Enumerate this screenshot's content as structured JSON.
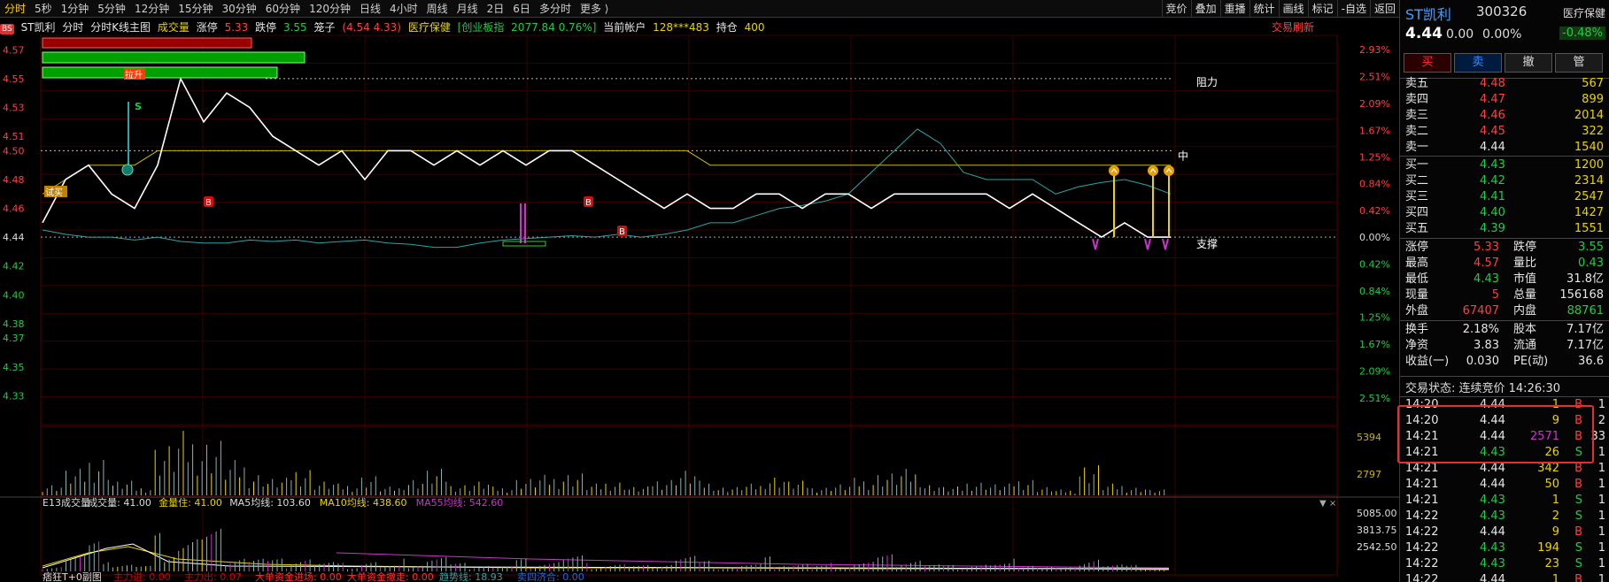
{
  "toolbar": {
    "periods": [
      "分时",
      "5秒",
      "1分钟",
      "5分钟",
      "12分钟",
      "15分钟",
      "30分钟",
      "60分钟",
      "120分钟",
      "日线",
      "4小时",
      "周线",
      "月线",
      "2日",
      "6日",
      "多分时",
      "更多 ⟩"
    ],
    "active_period": 0,
    "tools": [
      "竞价",
      "叠加",
      "重播",
      "统计",
      "画线",
      "标记",
      "-自选",
      "返回"
    ]
  },
  "infoline": {
    "tag": "BS",
    "stock": "ST凯利",
    "mode": "分时",
    "main_chart": "分时K线主图",
    "volume_label": "成交量",
    "limit_up_label": "涨停",
    "limit_up": "5.33",
    "limit_down_label": "跌停",
    "limit_down": "3.55",
    "box_label": "笼子",
    "box_value": "(4.54 4.33)",
    "sector": "医疗保健",
    "index_label": "[创业板指",
    "index_value": "2077.84 0.76%]",
    "account_label": "当前帐户",
    "account": "128***483",
    "position_label": "持仓",
    "position": "400",
    "trade_refresh": "交易刷新"
  },
  "price_axis": [
    "4.57",
    "4.55",
    "4.53",
    "4.51",
    "4.50",
    "4.48",
    "4.46",
    "4.44",
    "4.42",
    "4.40",
    "4.38",
    "4.37",
    "4.35",
    "4.33"
  ],
  "pct_axis_up": [
    "2.93%",
    "2.51%",
    "2.09%",
    "1.67%",
    "1.25%",
    "0.84%",
    "0.42%",
    "0.00%"
  ],
  "pct_axis_down": [
    "0.42%",
    "0.84%",
    "1.25%",
    "1.67%",
    "2.09%",
    "2.51%"
  ],
  "annotations": {
    "resistance": "阻力",
    "middle": "中",
    "support": "支撑",
    "rise": "拉升",
    "buy": "试买",
    "b": "B",
    "s": "S"
  },
  "volume_axis": [
    "5394",
    "2797"
  ],
  "e13": {
    "title": "E13成交量",
    "vol_label": "成交量: 41.00",
    "amount_label": "金量住: 41.00",
    "ma5": "MA5均线: 103.60",
    "ma10": "MA10均线: 438.60",
    "ma55": "MA55均线: 542.60",
    "axis": [
      "5085.00",
      "3813.75",
      "2542.50"
    ]
  },
  "bottom_line": {
    "title": "痞狂T+0副图",
    "items": [
      "主力进: 0.00",
      "主力出: 0.07",
      "大单资金进场: 0.00",
      "大单资金撤走: 0.00",
      "趋势线: 18.93",
      "卖四济合: 0.00"
    ]
  },
  "chart_data": {
    "type": "line",
    "title": "ST凯利 分时",
    "series": [
      {
        "name": "price",
        "values": [
          4.45,
          4.48,
          4.49,
          4.47,
          4.46,
          4.49,
          4.55,
          4.52,
          4.54,
          4.53,
          4.51,
          4.5,
          4.49,
          4.5,
          4.48,
          4.5,
          4.5,
          4.49,
          4.5,
          4.49,
          4.5,
          4.49,
          4.5,
          4.5,
          4.49,
          4.48,
          4.47,
          4.46,
          4.47,
          4.46,
          4.46,
          4.47,
          4.47,
          4.46,
          4.47,
          4.47,
          4.46,
          4.47,
          4.47,
          4.47,
          4.47,
          4.47,
          4.46,
          4.47,
          4.46,
          4.45,
          4.44,
          4.45,
          4.44,
          4.44
        ]
      },
      {
        "name": "avg",
        "values": [
          4.47,
          4.48,
          4.49,
          4.49,
          4.49,
          4.5,
          4.5,
          4.5,
          4.5,
          4.5,
          4.5,
          4.5,
          4.5,
          4.5,
          4.5,
          4.5,
          4.5,
          4.5,
          4.5,
          4.5,
          4.5,
          4.5,
          4.5,
          4.5,
          4.5,
          4.5,
          4.5,
          4.5,
          4.5,
          4.49,
          4.49,
          4.49,
          4.49,
          4.49,
          4.49,
          4.49,
          4.49,
          4.49,
          4.49,
          4.49,
          4.49,
          4.49,
          4.49,
          4.49,
          4.49,
          4.49,
          4.49,
          4.49,
          4.49,
          4.49
        ]
      },
      {
        "name": "index",
        "values": [
          4.445,
          4.442,
          4.44,
          4.44,
          4.438,
          4.44,
          4.437,
          4.436,
          4.436,
          4.438,
          4.437,
          4.438,
          4.436,
          4.437,
          4.438,
          4.436,
          4.435,
          4.433,
          4.433,
          4.436,
          4.438,
          4.439,
          4.44,
          4.441,
          4.44,
          4.442,
          4.44,
          4.442,
          4.445,
          4.45,
          4.45,
          4.455,
          4.46,
          4.462,
          4.465,
          4.47,
          4.485,
          4.5,
          4.515,
          4.505,
          4.485,
          4.48,
          4.48,
          4.48,
          4.47,
          4.475,
          4.478,
          4.48,
          4.476,
          4.47
        ]
      }
    ],
    "ylim": [
      4.31,
      4.58
    ],
    "reference_price": 4.44,
    "volume": [
      4,
      9,
      14,
      5,
      3,
      18,
      22,
      20,
      12,
      8,
      6,
      10,
      5,
      4,
      7,
      3,
      6,
      9,
      4,
      5,
      3,
      6,
      7,
      8,
      4,
      5,
      3,
      6,
      9,
      5,
      3,
      4,
      7,
      5,
      3,
      4,
      6,
      8,
      9,
      4,
      3,
      5,
      4,
      6,
      3,
      2,
      11,
      4,
      3,
      2
    ]
  },
  "right_panel": {
    "name": "ST凯利",
    "code": "300326",
    "sector": "医疗保健",
    "price": "4.44",
    "change": "0.00",
    "change_pct": "0.00%",
    "sector_pct": "-0.48%",
    "buttons": [
      "买",
      "卖",
      "撤",
      "管"
    ],
    "asks": [
      {
        "label": "卖五",
        "price": "4.48",
        "vol": "567"
      },
      {
        "label": "卖四",
        "price": "4.47",
        "vol": "899"
      },
      {
        "label": "卖三",
        "price": "4.46",
        "vol": "2014"
      },
      {
        "label": "卖二",
        "price": "4.45",
        "vol": "322"
      },
      {
        "label": "卖一",
        "price": "4.44",
        "vol": "1540"
      }
    ],
    "bids": [
      {
        "label": "买一",
        "price": "4.43",
        "vol": "1200"
      },
      {
        "label": "买二",
        "price": "4.42",
        "vol": "2314"
      },
      {
        "label": "买三",
        "price": "4.41",
        "vol": "2547"
      },
      {
        "label": "买四",
        "price": "4.40",
        "vol": "1427"
      },
      {
        "label": "买五",
        "price": "4.39",
        "vol": "1551"
      }
    ],
    "stats": [
      {
        "l1": "涨停",
        "v1": "5.33",
        "c1": "c-red",
        "l2": "跌停",
        "v2": "3.55",
        "c2": "c-green"
      },
      {
        "l1": "最高",
        "v1": "4.57",
        "c1": "c-red",
        "l2": "量比",
        "v2": "0.43",
        "c2": "c-green"
      },
      {
        "l1": "最低",
        "v1": "4.43",
        "c1": "c-green",
        "l2": "市值",
        "v2": "31.8亿",
        "c2": "c-white"
      },
      {
        "l1": "现量",
        "v1": "5",
        "c1": "c-red",
        "l2": "总量",
        "v2": "156168",
        "c2": "c-white"
      },
      {
        "l1": "外盘",
        "v1": "67407",
        "c1": "c-red",
        "l2": "内盘",
        "v2": "88761",
        "c2": "c-green"
      }
    ],
    "stats2": [
      {
        "l1": "换手",
        "v1": "2.18%",
        "l2": "股本",
        "v2": "7.17亿"
      },
      {
        "l1": "净资",
        "v1": "3.83",
        "l2": "流通",
        "v2": "7.17亿"
      },
      {
        "l1": "收益(一)",
        "v1": "0.030",
        "l2": "PE(动)",
        "v2": "36.6"
      }
    ],
    "trade_status": "交易状态: 连续竞价 14:26:30",
    "ticks": [
      {
        "t": "14:20",
        "p": "4.44",
        "pc": "c-white",
        "v": "1",
        "vc": "c-yellow",
        "d": "B",
        "n": "1"
      },
      {
        "t": "14:20",
        "p": "4.44",
        "pc": "c-white",
        "v": "9",
        "vc": "c-yellow",
        "d": "B",
        "n": "2"
      },
      {
        "t": "14:21",
        "p": "4.44",
        "pc": "c-white",
        "v": "2571",
        "vc": "c-purple",
        "d": "B",
        "n": "33"
      },
      {
        "t": "14:21",
        "p": "4.43",
        "pc": "c-green",
        "v": "26",
        "vc": "c-yellow",
        "d": "S",
        "n": "1"
      },
      {
        "t": "14:21",
        "p": "4.44",
        "pc": "c-white",
        "v": "342",
        "vc": "c-yellow",
        "d": "B",
        "n": "1"
      },
      {
        "t": "14:21",
        "p": "4.44",
        "pc": "c-white",
        "v": "50",
        "vc": "c-yellow",
        "d": "B",
        "n": "1"
      },
      {
        "t": "14:21",
        "p": "4.43",
        "pc": "c-green",
        "v": "1",
        "vc": "c-yellow",
        "d": "S",
        "n": "1"
      },
      {
        "t": "14:22",
        "p": "4.43",
        "pc": "c-green",
        "v": "2",
        "vc": "c-yellow",
        "d": "S",
        "n": "1"
      },
      {
        "t": "14:22",
        "p": "4.44",
        "pc": "c-white",
        "v": "9",
        "vc": "c-yellow",
        "d": "B",
        "n": "1"
      },
      {
        "t": "14:22",
        "p": "4.43",
        "pc": "c-green",
        "v": "194",
        "vc": "c-yellow",
        "d": "S",
        "n": "1"
      },
      {
        "t": "14:22",
        "p": "4.43",
        "pc": "c-green",
        "v": "23",
        "vc": "c-yellow",
        "d": "S",
        "n": "1"
      },
      {
        "t": "14:22",
        "p": "4.44",
        "pc": "c-white",
        "v": "1",
        "vc": "c-yellow",
        "d": "B",
        "n": "1"
      }
    ]
  }
}
